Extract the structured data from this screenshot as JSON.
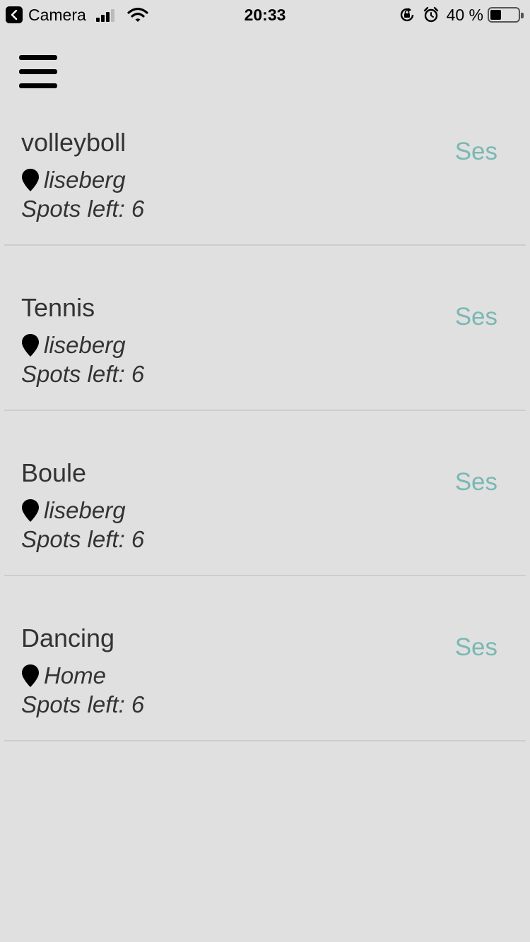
{
  "status_bar": {
    "back_app": "Camera",
    "time": "20:33",
    "battery_percent": "40 %",
    "battery_level": 0.4,
    "signal_bars": 3
  },
  "menu": {
    "icon": "hamburger-menu-icon"
  },
  "activities": [
    {
      "title": "volleyboll",
      "location": "liseberg",
      "spots": "Spots left: 6",
      "action": "Ses"
    },
    {
      "title": "Tennis",
      "location": "liseberg",
      "spots": "Spots left: 6",
      "action": "Ses"
    },
    {
      "title": "Boule",
      "location": "liseberg",
      "spots": "Spots left: 6",
      "action": "Ses"
    },
    {
      "title": "Dancing",
      "location": "Home",
      "spots": "Spots left: 6",
      "action": "Ses"
    }
  ],
  "colors": {
    "background": "#e0e0e0",
    "accent": "#7ab8b4",
    "text": "#333333",
    "divider": "#cdcdcd"
  }
}
